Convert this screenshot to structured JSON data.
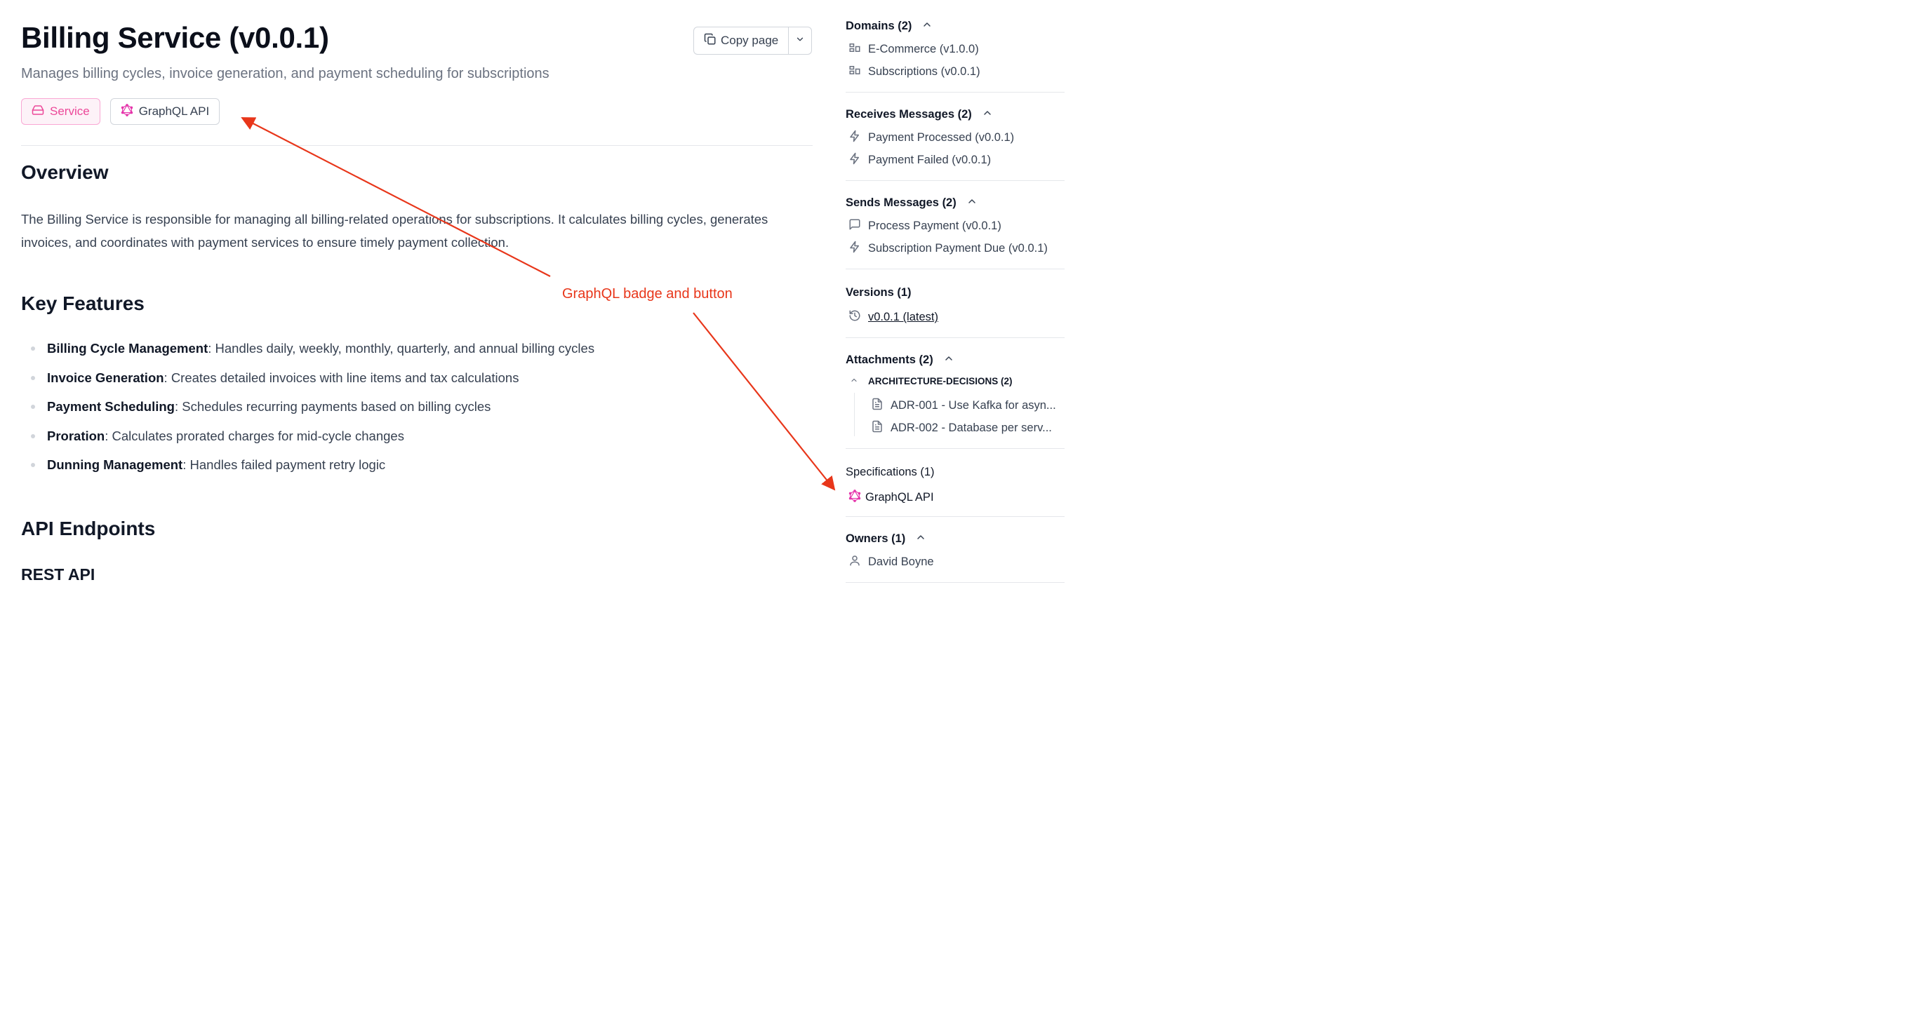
{
  "header": {
    "title": "Billing Service (v0.0.1)",
    "subtitle": "Manages billing cycles, invoice generation, and payment scheduling for subscriptions",
    "copy_label": "Copy page"
  },
  "badges": [
    {
      "label": "Service",
      "icon": "server-icon"
    },
    {
      "label": "GraphQL API",
      "icon": "graphql-icon"
    }
  ],
  "overview": {
    "heading": "Overview",
    "text": "The Billing Service is responsible for managing all billing-related operations for subscriptions. It calculates billing cycles, generates invoices, and coordinates with payment services to ensure timely payment collection."
  },
  "key_features": {
    "heading": "Key Features",
    "items": [
      {
        "name": "Billing Cycle Management",
        "desc": ": Handles daily, weekly, monthly, quarterly, and annual billing cycles"
      },
      {
        "name": "Invoice Generation",
        "desc": ": Creates detailed invoices with line items and tax calculations"
      },
      {
        "name": "Payment Scheduling",
        "desc": ": Schedules recurring payments based on billing cycles"
      },
      {
        "name": "Proration",
        "desc": ": Calculates prorated charges for mid-cycle changes"
      },
      {
        "name": "Dunning Management",
        "desc": ": Handles failed payment retry logic"
      }
    ]
  },
  "api": {
    "heading": "API Endpoints",
    "rest_heading": "REST API"
  },
  "sidebar": {
    "domains": {
      "title": "Domains (2)",
      "items": [
        "E-Commerce (v1.0.0)",
        "Subscriptions (v0.0.1)"
      ]
    },
    "receives": {
      "title": "Receives Messages (2)",
      "items": [
        "Payment Processed (v0.0.1)",
        "Payment Failed (v0.0.1)"
      ]
    },
    "sends": {
      "title": "Sends Messages (2)",
      "items": [
        "Process Payment (v0.0.1)",
        "Subscription Payment Due (v0.0.1)"
      ]
    },
    "versions": {
      "title": "Versions (1)",
      "items": [
        "v0.0.1 (latest)"
      ]
    },
    "attachments": {
      "title": "Attachments (2)",
      "group": "ARCHITECTURE-DECISIONS (2)",
      "items": [
        "ADR-001 - Use Kafka for asyn...",
        "ADR-002 - Database per serv..."
      ]
    },
    "specifications": {
      "title": "Specifications (1)",
      "items": [
        "GraphQL API"
      ]
    },
    "owners": {
      "title": "Owners (1)",
      "items": [
        "David Boyne"
      ]
    }
  },
  "annotation": {
    "text": "GraphQL badge and button",
    "color": "#e8361a"
  },
  "colors": {
    "accent_pink": "#ec4899",
    "graphql_magenta": "#e535ab",
    "annotation_red": "#e8361a"
  }
}
